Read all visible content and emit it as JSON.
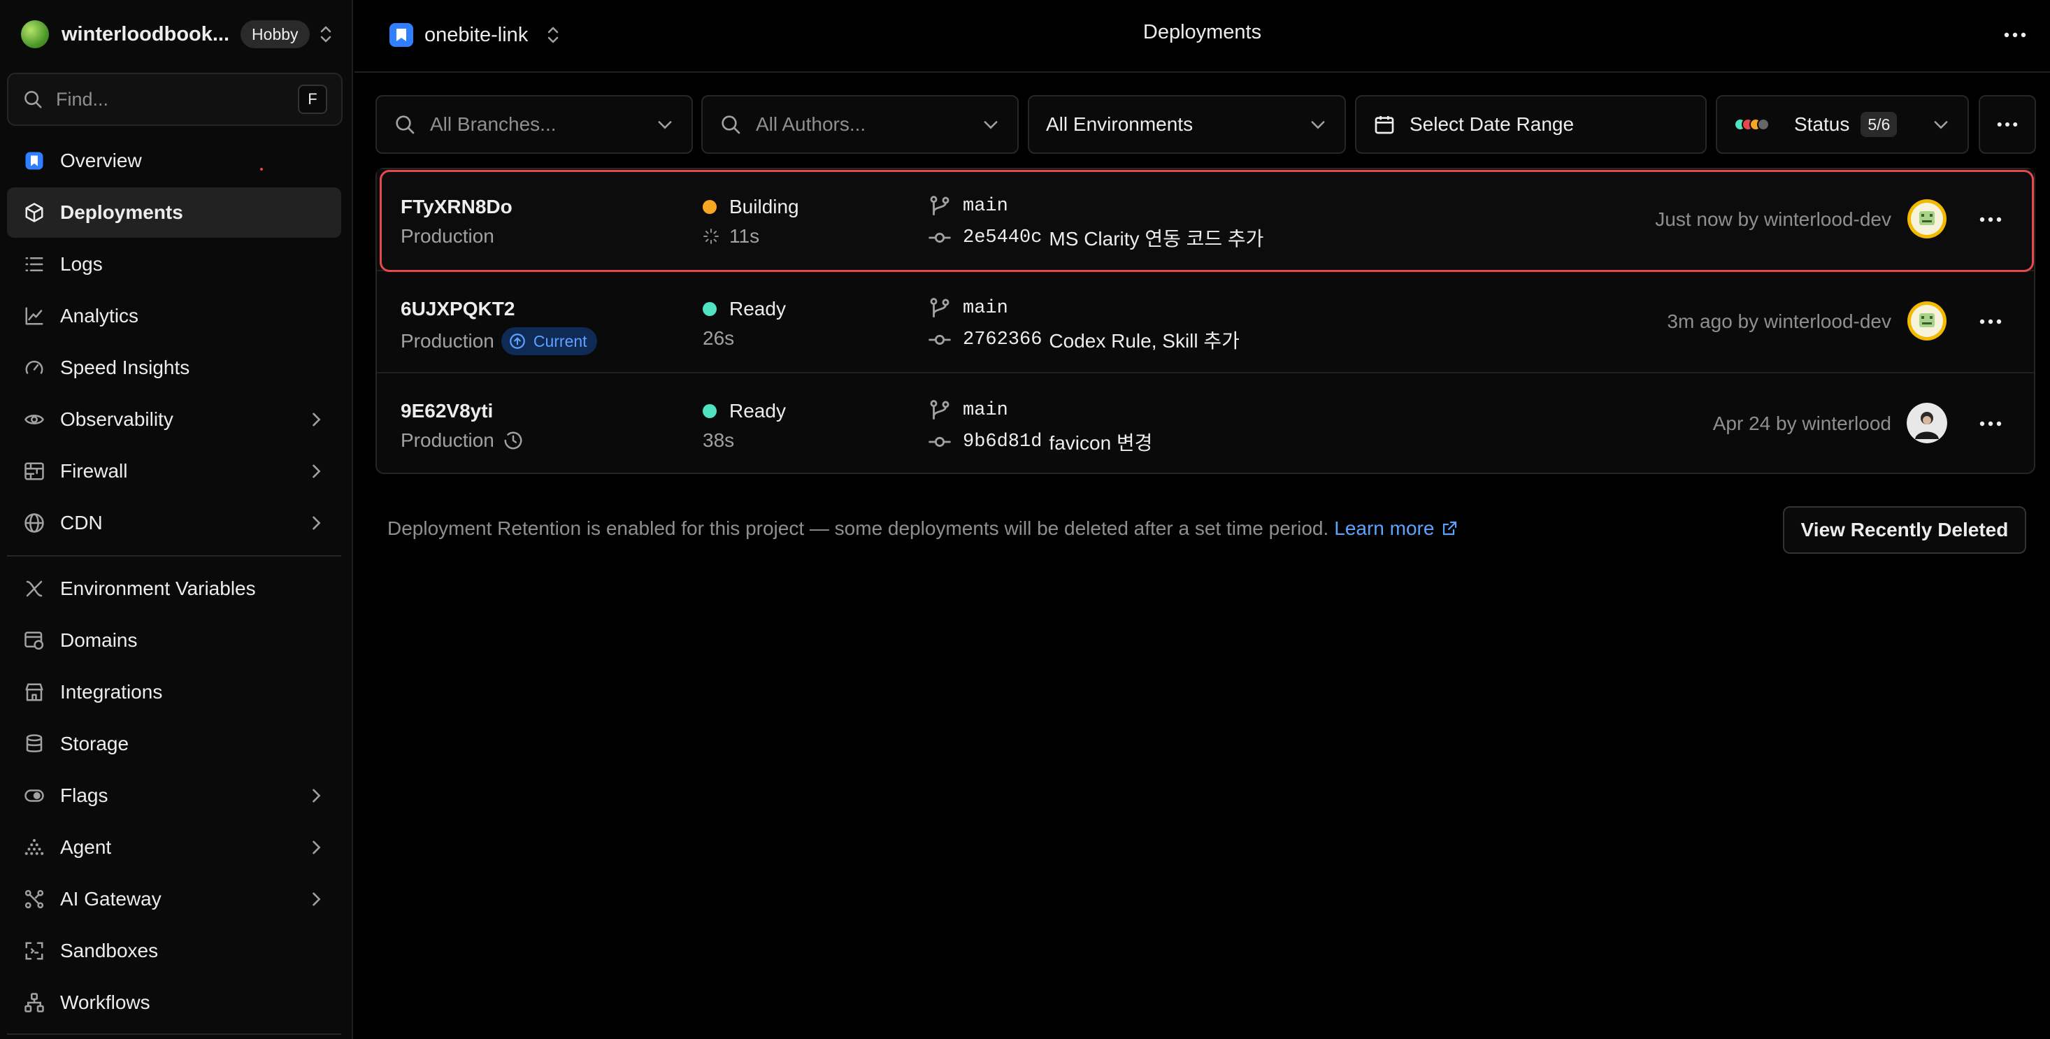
{
  "team": {
    "name": "winterloodbook...",
    "plan": "Hobby",
    "find_placeholder": "Find...",
    "find_shortcut": "F"
  },
  "sidebar": {
    "items": [
      {
        "label": "Overview",
        "icon": "project-icon"
      },
      {
        "label": "Deployments",
        "icon": "cube-icon",
        "active": true
      },
      {
        "label": "Logs",
        "icon": "list-icon"
      },
      {
        "label": "Analytics",
        "icon": "chart-line-icon"
      },
      {
        "label": "Speed Insights",
        "icon": "gauge-icon"
      },
      {
        "label": "Observability",
        "icon": "eye-icon",
        "expandable": true
      },
      {
        "label": "Firewall",
        "icon": "firewall-icon",
        "expandable": true
      },
      {
        "label": "CDN",
        "icon": "globe-icon",
        "expandable": true
      },
      {
        "label": "Environment Variables",
        "icon": "variables-icon"
      },
      {
        "label": "Domains",
        "icon": "domains-icon"
      },
      {
        "label": "Integrations",
        "icon": "store-icon"
      },
      {
        "label": "Storage",
        "icon": "database-icon"
      },
      {
        "label": "Flags",
        "icon": "toggle-icon",
        "expandable": true
      },
      {
        "label": "Agent",
        "icon": "agent-icon",
        "expandable": true
      },
      {
        "label": "AI Gateway",
        "icon": "gateway-icon",
        "expandable": true
      },
      {
        "label": "Sandboxes",
        "icon": "sandbox-icon"
      },
      {
        "label": "Workflows",
        "icon": "workflow-icon"
      }
    ]
  },
  "header": {
    "project_name": "onebite-link",
    "page_title": "Deployments"
  },
  "filters": {
    "branches_placeholder": "All Branches...",
    "authors_placeholder": "All Authors...",
    "environments": "All Environments",
    "date_range": "Select Date Range",
    "status_label": "Status",
    "status_count": "5/6"
  },
  "deployments": [
    {
      "id": "FTyXRN8Do",
      "environment": "Production",
      "current": false,
      "status": "Building",
      "status_color": "#f5a623",
      "duration": "11s",
      "branch": "main",
      "commit_sha": "2e5440c",
      "commit_message": "MS Clarity 연동 코드 추가",
      "meta": "Just now by winterlood-dev"
    },
    {
      "id": "6UJXPQKT2",
      "environment": "Production",
      "current": true,
      "current_label": "Current",
      "status": "Ready",
      "status_color": "#50e3c2",
      "duration": "26s",
      "branch": "main",
      "commit_sha": "2762366",
      "commit_message": "Codex Rule, Skill 추가",
      "meta": "3m ago by winterlood-dev"
    },
    {
      "id": "9E62V8yti",
      "environment": "Production",
      "current": false,
      "status": "Ready",
      "status_color": "#50e3c2",
      "duration": "38s",
      "branch": "main",
      "commit_sha": "9b6d81d",
      "commit_message": "favicon 변경",
      "meta": "Apr 24 by winterlood"
    }
  ],
  "retention": {
    "text": "Deployment Retention is enabled for this project — some deployments will be deleted after a set time period.",
    "link": "Learn more",
    "button": "View Recently Deleted"
  },
  "colors": {
    "accent_blue": "#5ea2ff",
    "building": "#f5a623",
    "ready": "#50e3c2",
    "highlight": "#e5484d"
  }
}
